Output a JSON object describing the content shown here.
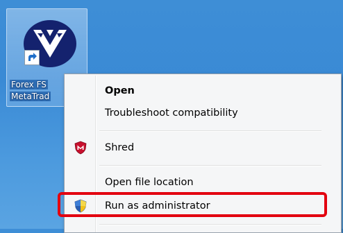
{
  "desktop": {
    "background_color": "#3e8ed6",
    "shortcut": {
      "label_lines": [
        "Forex FS",
        "MetaTrad"
      ],
      "icon": "metatrader-logo-icon",
      "overlay_icon": "shortcut-arrow-icon"
    }
  },
  "context_menu": {
    "items": [
      {
        "label": "Open",
        "bold": true,
        "icon": null
      },
      {
        "label": "Troubleshoot compatibility",
        "bold": false,
        "icon": null
      },
      {
        "label": "Shred",
        "bold": false,
        "icon": "mcafee-shield-icon"
      },
      {
        "label": "Open file location",
        "bold": false,
        "icon": null
      },
      {
        "label": "Run as administrator",
        "bold": false,
        "icon": "uac-shield-icon"
      }
    ]
  },
  "annotation": {
    "highlight_color": "#e3000f",
    "highlighted_item": "Run as administrator"
  }
}
